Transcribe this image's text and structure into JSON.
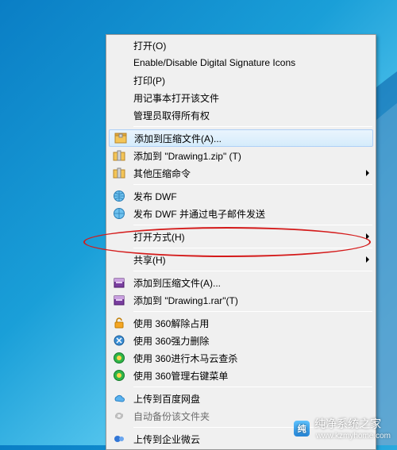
{
  "menu": {
    "open": "打开(O)",
    "sig": "Enable/Disable Digital Signature Icons",
    "print": "打印(P)",
    "notepad": "用记事本打开该文件",
    "admin": "管理员取得所有权",
    "addToArchive": "添加到压缩文件(A)...",
    "addToZip": "添加到 \"Drawing1.zip\" (T)",
    "otherZip": "其他压缩命令",
    "pubDwf": "发布 DWF",
    "pubDwfEmail": "发布 DWF 并通过电子邮件发送",
    "openWith": "打开方式(H)",
    "share": "共享(H)",
    "addToArchive2": "添加到压缩文件(A)...",
    "addToRar": "添加到 \"Drawing1.rar\"(T)",
    "unlock360": "使用 360解除占用",
    "forceDel360": "使用 360强力删除",
    "trojan360": "使用 360进行木马云查杀",
    "manage360": "使用 360管理右键菜单",
    "uploadBaidu": "上传到百度网盘",
    "autoBackup": "自动备份该文件夹",
    "uploadWecom": "上传到企业微云"
  },
  "watermark": {
    "title": "纯净系统之家",
    "url": "www.kzmyhome.com"
  }
}
